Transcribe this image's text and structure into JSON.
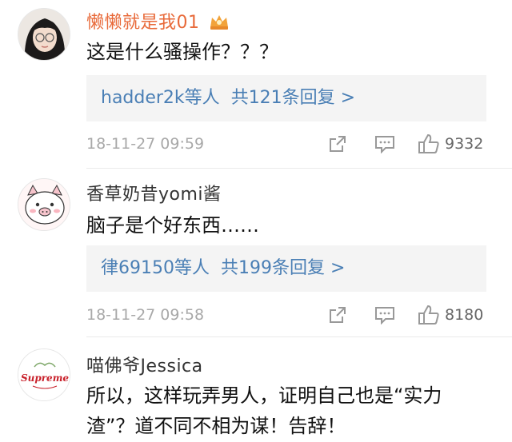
{
  "comments": [
    {
      "username": "懒懒就是我01",
      "username_color": "#e86a3a",
      "badge_icon": "crown-badge-icon",
      "text": "这是什么骚操作？？？",
      "reply_users": "hadder2k等人",
      "reply_count": "共121条回复 >",
      "timestamp": "18-11-27 09:59",
      "likes": "9332"
    },
    {
      "username": "香草奶昔yomi酱",
      "username_color": "#333333",
      "text": "脑子是个好东西……",
      "reply_users": "律69150等人",
      "reply_count": "共199条回复 >",
      "timestamp": "18-11-27 09:58",
      "likes": "8180"
    },
    {
      "username": "喵佛爷Jessica",
      "username_color": "#333333",
      "text_line1": "所以，这样玩弄男人，证明自己也是“实力",
      "text_line2": "渣”？道不同不相为谋！告辞！",
      "avatar_text": "Supreme"
    }
  ],
  "colors": {
    "link": "#4a7fb5",
    "meta": "#a8a8a8",
    "reply_bg": "#f4f4f4"
  }
}
